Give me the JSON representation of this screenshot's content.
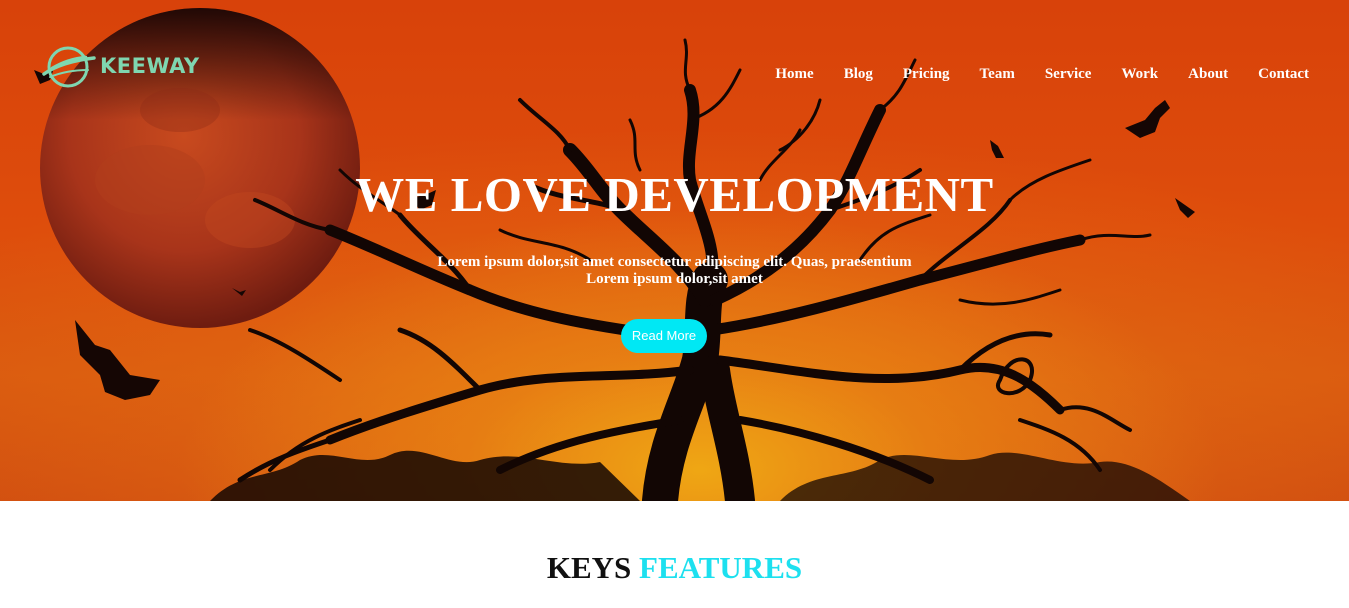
{
  "brand": {
    "name": "KEEWAY",
    "icon": "globe-swoosh-icon",
    "color": "#7fd6b0"
  },
  "nav": {
    "items": [
      "Home",
      "Blog",
      "Pricing",
      "Team",
      "Service",
      "Work",
      "About",
      "Contact"
    ]
  },
  "hero": {
    "title": "WE LOVE DEVELOPMENT",
    "subtitle_line1": "Lorem ipsum dolor,sit amet consectetur adipiscing elit. Quas, praesentium",
    "subtitle_line2": "Lorem ipsum dolor,sit amet",
    "cta_label": "Read More",
    "cta_color": "#00e8f4",
    "background_colors": [
      "#d8420a",
      "#e88a14"
    ],
    "image": "halloween-moon-bats-tree"
  },
  "features": {
    "title_word1": "KEYS",
    "title_word2": "FEATURES",
    "accent_color": "#1de0ef"
  }
}
